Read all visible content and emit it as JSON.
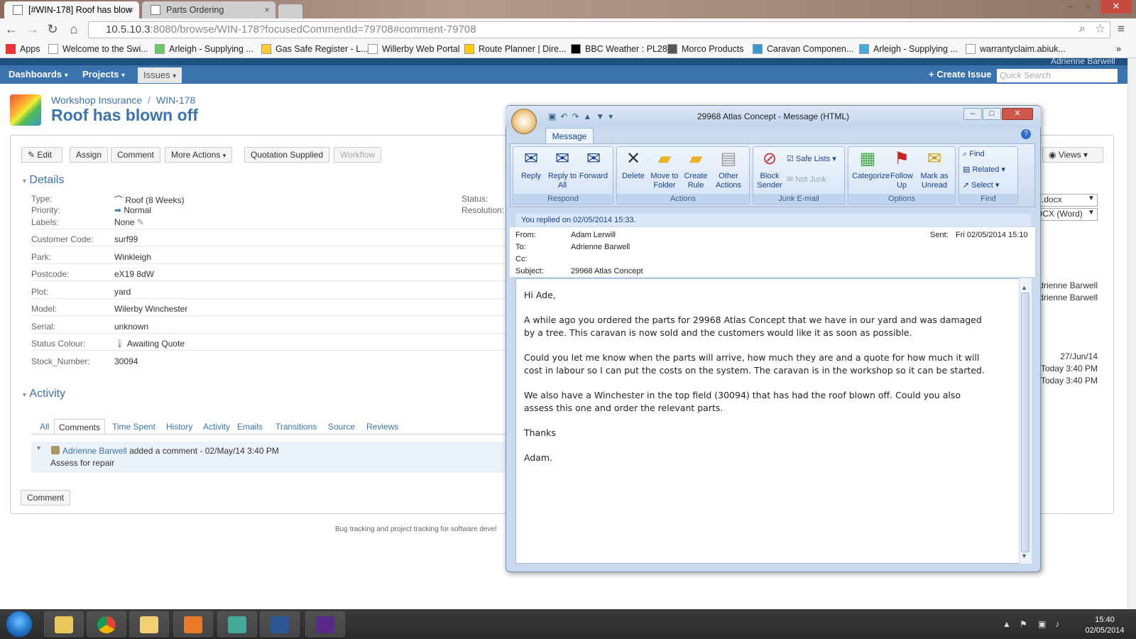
{
  "browser": {
    "tabs": [
      {
        "title": "[#WIN-178] Roof has blow",
        "close": "×"
      },
      {
        "title": "Parts Ordering",
        "close": "×"
      }
    ],
    "window_controls": [
      "–",
      "▫",
      "✕"
    ],
    "url_host": "10.5.10.3",
    "url_rest": ":8080/browse/WIN-178?focusedCommentId=79708#comment-79708",
    "bookmarks": [
      "Apps",
      "Welcome to the Swi...",
      "Arleigh - Supplying ...",
      "Gas Safe Register - L...",
      "Willerby Web Portal",
      "Route Planner | Dire...",
      "BBC Weather : PL28",
      "Morco Products",
      "Caravan Componen...",
      "Arleigh - Supplying ...",
      "warrantyclaim.abiuk..."
    ],
    "bookmark_more": "»"
  },
  "jira": {
    "nav": {
      "dashboards": "Dashboards",
      "projects": "Projects",
      "issues": "Issues",
      "create": "Create Issue",
      "search_placeholder": "Quick Search",
      "user": "Adrienne Barwell"
    },
    "breadcrumb": {
      "project": "Workshop Insurance",
      "sep": "/",
      "key": "WIN-178"
    },
    "title": "Roof has blown off",
    "toolbar": [
      "Edit",
      "Assign",
      "Comment",
      "More Actions",
      "Quotation Supplied",
      "Workflow"
    ],
    "views": "Views",
    "details_heading": "Details",
    "details": [
      {
        "label": "Type:",
        "value": "Roof (8 Weeks)"
      },
      {
        "label": "Priority:",
        "value": "Normal"
      },
      {
        "label": "Labels:",
        "value": "None"
      },
      {
        "label": "Customer Code:",
        "value": "surf99"
      },
      {
        "label": "Park:",
        "value": "Winkleigh"
      },
      {
        "label": "Postcode:",
        "value": "eX19 8dW"
      },
      {
        "label": "Plot:",
        "value": "yard"
      },
      {
        "label": "Model:",
        "value": "Wilerby Winchester"
      },
      {
        "label": "Serial:",
        "value": "unknown"
      },
      {
        "label": "Status Colour:",
        "value": "Awaiting Quote"
      },
      {
        "label": "Stock_Number:",
        "value": "30094"
      }
    ],
    "status_label": "Status:",
    "resolution_label": "Resolution:",
    "right_fragments": {
      "file1": "K.docx",
      "file2": "OCX (Word)",
      "people1": "drienne Barwell",
      "people2": "drienne Barwell",
      "date1": "27/Jun/14",
      "date2": "Today 3:40 PM",
      "date3": "Today 3:40 PM"
    },
    "activity_heading": "Activity",
    "activity_tabs": [
      "All",
      "Comments",
      "Time Spent",
      "History",
      "Activity",
      "Emails",
      "Transitions",
      "Source",
      "Reviews"
    ],
    "comment": {
      "author": "Adrienne Barwell",
      "meta": "added a comment - 02/May/14 3:40 PM",
      "text": "Assess for repair"
    },
    "comment_button": "Comment",
    "footer": "Bug tracking and project tracking for software devel"
  },
  "outlook": {
    "title": "29968 Atlas Concept - Message (HTML)",
    "ribbon_tab": "Message",
    "groups": {
      "respond": {
        "label": "Respond",
        "buttons": [
          "Reply",
          "Reply to All",
          "Forward"
        ]
      },
      "actions": {
        "label": "Actions",
        "buttons": [
          "Delete",
          "Move to Folder",
          "Create Rule",
          "Other Actions"
        ]
      },
      "junk": {
        "label": "Junk E-mail",
        "buttons": [
          "Block Sender",
          "Safe Lists",
          "Not Junk"
        ]
      },
      "options": {
        "label": "Options",
        "buttons": [
          "Categorize",
          "Follow Up",
          "Mark as Unread"
        ]
      },
      "find": {
        "label": "Find",
        "buttons": [
          "Find",
          "Related",
          "Select"
        ]
      }
    },
    "replied_notice": "You replied on 02/05/2014 15:33.",
    "from_label": "From:",
    "from": "Adam Lerwill",
    "to_label": "To:",
    "to": "Adrienne Barwell",
    "cc_label": "Cc:",
    "subject_label": "Subject:",
    "subject": "29968 Atlas Concept",
    "sent_label": "Sent:",
    "sent": "Fri 02/05/2014 15:10",
    "body": [
      "Hi Ade,",
      "A while ago you ordered the parts for 29968 Atlas Concept that we have in our yard and was damaged by a tree.  This caravan is now sold and the customers would like it as soon as possible.",
      "Could you let me know when the parts will arrive, how much they are and a quote for how much it will cost in labour so I can put the costs on the system.  The caravan is in the workshop so it can be started.",
      "We also have a Winchester in the top field (30094) that has had the roof blown off.  Could you also assess this one and order the relevant parts.",
      "Thanks",
      "Adam."
    ]
  },
  "taskbar": {
    "time": "15:40",
    "date": "02/05/2014"
  }
}
